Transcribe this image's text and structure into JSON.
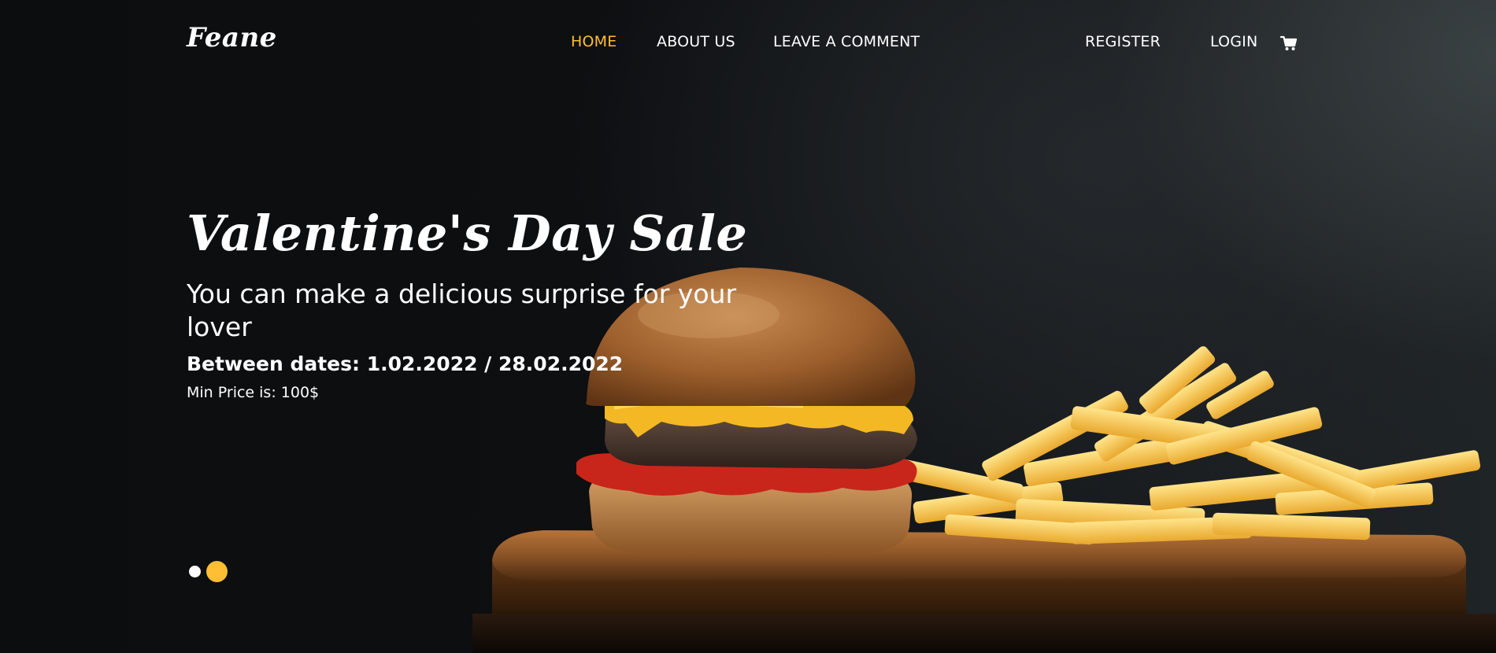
{
  "brand": "Feane",
  "nav": {
    "home": "HOME",
    "about": "ABOUT US",
    "comment": "LEAVE A COMMENT",
    "register": "REGISTER",
    "login": "LOGIN",
    "cart_icon": "cart-icon"
  },
  "hero": {
    "title": "Valentine's Day Sale",
    "subtitle": "You can make a delicious surprise for your lover",
    "dates": "Between dates: 1.02.2022 / 28.02.2022",
    "min_price": "Min Price is: 100$"
  },
  "carousel": {
    "slide_count": 2,
    "active_index": 1
  },
  "colors": {
    "accent": "#ffbe33",
    "background": "#0d0f11",
    "text": "#ffffff"
  },
  "image": {
    "icon": "burger-and-fries-image"
  }
}
